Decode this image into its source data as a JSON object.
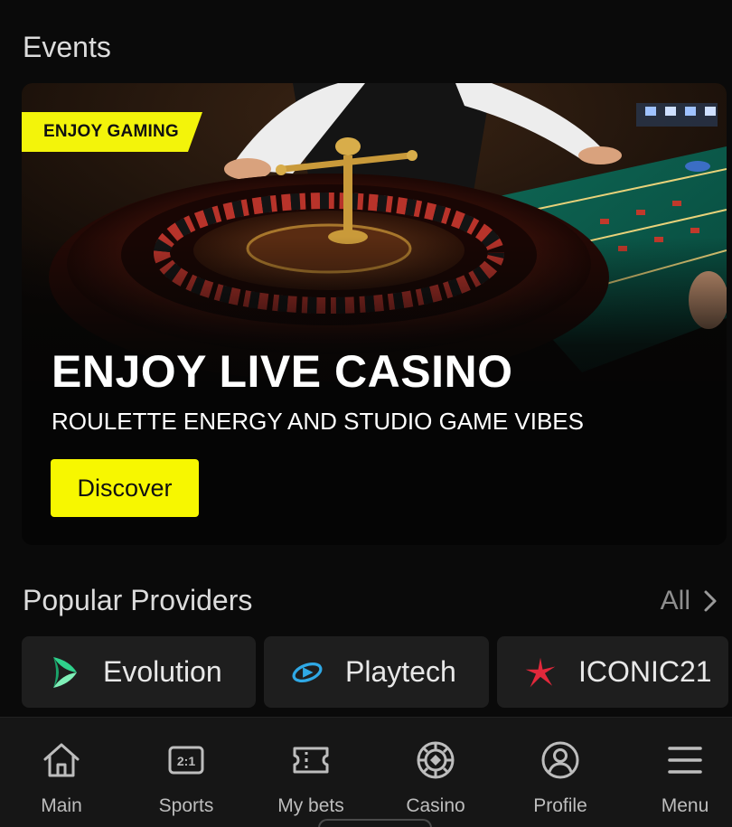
{
  "events": {
    "section_title": "Events",
    "banner": {
      "tag": "ENJOY GAMING",
      "title": "ENJOY LIVE CASINO",
      "subtitle": "ROULETTE ENERGY AND STUDIO GAME VIBES",
      "cta_label": "Discover",
      "tag_color": "#f3f40a",
      "cta_color": "#f7f700"
    }
  },
  "providers": {
    "section_title": "Popular Providers",
    "all_label": "All",
    "items": [
      {
        "name": "Evolution",
        "icon": "evolution-logo-icon"
      },
      {
        "name": "Playtech",
        "icon": "playtech-logo-icon"
      },
      {
        "name": "ICONIC21",
        "icon": "iconic21-star-icon"
      }
    ]
  },
  "bottom_nav": {
    "items": [
      {
        "label": "Main",
        "icon": "home-icon"
      },
      {
        "label": "Sports",
        "icon": "scoreboard-icon"
      },
      {
        "label": "My bets",
        "icon": "ticket-icon"
      },
      {
        "label": "Casino",
        "icon": "casino-chip-icon"
      },
      {
        "label": "Profile",
        "icon": "user-circle-icon"
      },
      {
        "label": "Menu",
        "icon": "hamburger-menu-icon"
      }
    ],
    "sports_icon_text": "2:1"
  }
}
